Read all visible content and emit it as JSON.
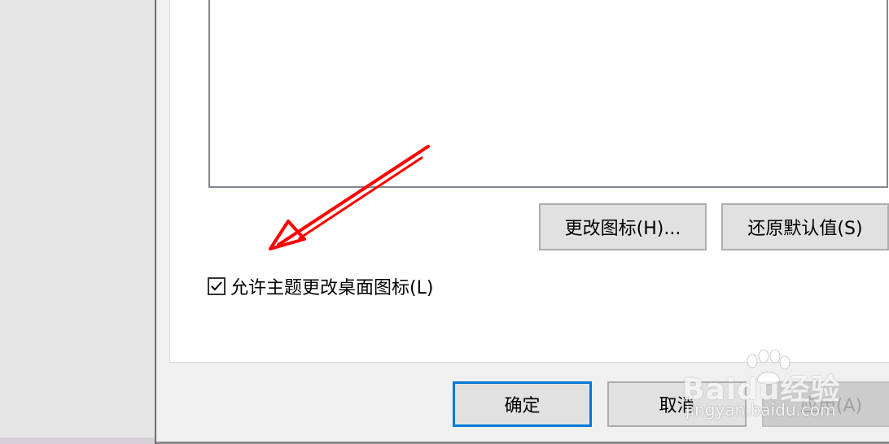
{
  "dialog": {
    "buttons": {
      "change_icon": "更改图标(H)...",
      "restore_default": "还原默认值(S)"
    },
    "checkbox": {
      "label": "允许主题更改桌面图标(L)",
      "checked": true
    },
    "footer": {
      "ok": "确定",
      "cancel": "取消",
      "apply": "应用(A)"
    }
  },
  "annotation": {
    "arrow_color": "#ff0000"
  },
  "watermark": {
    "logo_text": "Baidu经验",
    "url_text": "jingyan.baidu.com"
  },
  "colors": {
    "dialog_bg": "#f0f0f0",
    "panel_bg": "#ffffff",
    "focus_border": "#0078d7",
    "disabled_text": "#a0a0a0"
  }
}
